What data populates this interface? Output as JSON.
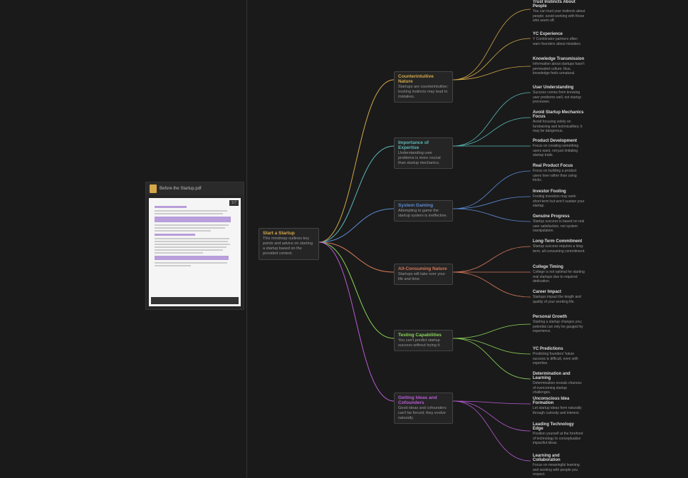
{
  "sidebar": {
    "filename": "Before the Startup.pdf",
    "badge": "1/7"
  },
  "root": {
    "title": "Start a Startup",
    "desc": "This mindmap outlines key points and advice on starting a startup based on the provided context."
  },
  "l2": [
    {
      "title": "Counterintuitive Nature",
      "desc": "Startups are counterintuitive; trusting instincts may lead to mistakes."
    },
    {
      "title": "Importance of Expertise",
      "desc": "Understanding user problems is more crucial than startup mechanics."
    },
    {
      "title": "System Gaming",
      "desc": "Attempting to game the startup system is ineffective."
    },
    {
      "title": "All-Consuming Nature",
      "desc": "Startups will take over your life and time."
    },
    {
      "title": "Testing Capabilities",
      "desc": "You can't predict startup success without trying it."
    },
    {
      "title": "Getting Ideas and Cofounders",
      "desc": "Good ideas and cofounders can't be forced; they evolve naturally."
    }
  ],
  "l3": [
    {
      "title": "Trust Instincts About People",
      "desc": "You can trust your instincts about people; avoid working with those who seem off."
    },
    {
      "title": "YC Experience",
      "desc": "Y Combinator partners often warn founders about mistakes."
    },
    {
      "title": "Knowledge Transmission",
      "desc": "Information about startups hasn't permeated culture; thus, knowledge feels unnatural."
    },
    {
      "title": "User Understanding",
      "desc": "Success comes from knowing user problems well, not startup processes."
    },
    {
      "title": "Avoid Startup Mechanics Focus",
      "desc": "Avoid focusing solely on fundraising and technicalities; it may be dangerous."
    },
    {
      "title": "Product Development",
      "desc": "Focus on creating something users want, not just imitating startup traits."
    },
    {
      "title": "Real Product Focus",
      "desc": "Focus on building a product users love rather than using tricks."
    },
    {
      "title": "Investor Fooling",
      "desc": "Fooling investors may work short-term but won't sustain your startup."
    },
    {
      "title": "Genuine Progress",
      "desc": "Startup success is based on real user satisfaction, not system manipulation."
    },
    {
      "title": "Long-Term Commitment",
      "desc": "Startup success requires a long-term, all-consuming commitment."
    },
    {
      "title": "College Timing",
      "desc": "College is not optimal for starting real startups due to required dedication."
    },
    {
      "title": "Career Impact",
      "desc": "Startups impact the length and quality of your working life."
    },
    {
      "title": "Personal Growth",
      "desc": "Starting a startup changes you; potential can only be gauged by experience."
    },
    {
      "title": "YC Predictions",
      "desc": "Predicting founders' future success is difficult, even with expertise."
    },
    {
      "title": "Determination and Learning",
      "desc": "Determination reveals chances of overcoming startup challenges."
    },
    {
      "title": "Unconscious Idea Formation",
      "desc": "Let startup ideas form naturally through curiosity and interest."
    },
    {
      "title": "Leading Technology Edge",
      "desc": "Position yourself at the forefront of technology to conceptualize impactful ideas."
    },
    {
      "title": "Learning and Collaboration",
      "desc": "Focus on meaningful learning and working with people you respect."
    }
  ],
  "colors": {
    "orange": "#d4a849",
    "teal": "#5bb8b8",
    "blue": "#5b8bd4",
    "red": "#d4785b",
    "green": "#8bd45b",
    "purple": "#b85bd4"
  }
}
